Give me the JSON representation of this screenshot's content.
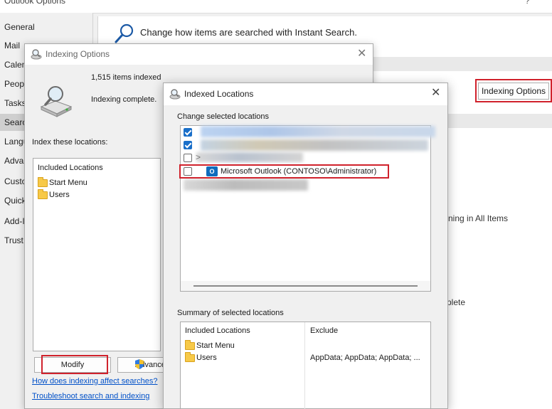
{
  "outlook_options": {
    "title": "Outlook Options",
    "help": "?",
    "nav": [
      {
        "label": "General"
      },
      {
        "label": "Mail"
      },
      {
        "label": "Calen"
      },
      {
        "label": "Peopl"
      },
      {
        "label": "Tasks"
      },
      {
        "label": "Searc"
      },
      {
        "label": "Langu"
      },
      {
        "label": "Adva"
      },
      {
        "label": "Custo"
      },
      {
        "label": "Quick"
      },
      {
        "label": "Add-I"
      },
      {
        "label": "Trust"
      }
    ],
    "selected_nav": "Searc",
    "heading": "Change how items are searched with Instant Search.",
    "indexing_options_button": "Indexing Options",
    "fragment_1": "ning in All Items",
    "fragment_2": "plete"
  },
  "indexing_options": {
    "title": "Indexing Options",
    "items_indexed": "1,515 items indexed",
    "status": "Indexing complete.",
    "index_label": "Index these locations:",
    "list_header": "Included Locations",
    "locations": [
      "Start Menu",
      "Users"
    ],
    "modify_button": "Modify",
    "advanced_button": "Advanced",
    "link_how": "How does indexing affect searches?",
    "link_troubleshoot": "Troubleshoot search and indexing",
    "close": "✕"
  },
  "indexed_locations": {
    "title": "Indexed Locations",
    "close": "✕",
    "change_label": "Change selected locations",
    "expander": ">",
    "outlook_icon": "O",
    "outlook_item": "Microsoft Outlook (CONTOSO\\Administrator)",
    "summary_label": "Summary of selected locations",
    "summary_columns": [
      "Included Locations",
      "Exclude"
    ],
    "summary_rows": [
      {
        "location": "Start Menu",
        "exclude": ""
      },
      {
        "location": "Users",
        "exclude": "AppData; AppData; AppData; ..."
      }
    ]
  },
  "colors": {
    "highlight": "#d0222c",
    "link": "#0050c8",
    "checkbox_checked": "#1a6fc9",
    "outlook_blue": "#0f6cbd"
  }
}
